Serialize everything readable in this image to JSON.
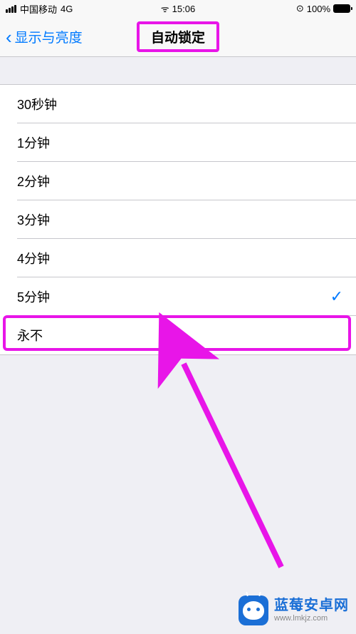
{
  "status": {
    "carrier": "中国移动",
    "network": "4G",
    "time": "15:06",
    "battery_pct": "100%",
    "lock_glyph": "⊙"
  },
  "nav": {
    "back_label": "显示与亮度",
    "title": "自动锁定"
  },
  "options": [
    {
      "label": "30秒钟",
      "selected": false
    },
    {
      "label": "1分钟",
      "selected": false
    },
    {
      "label": "2分钟",
      "selected": false
    },
    {
      "label": "3分钟",
      "selected": false
    },
    {
      "label": "4分钟",
      "selected": false
    },
    {
      "label": "5分钟",
      "selected": true
    },
    {
      "label": "永不",
      "selected": false
    }
  ],
  "annotation": {
    "highlight_color": "#e815e8"
  },
  "watermark": {
    "title": "蓝莓安卓网",
    "url": "www.lmkjz.com"
  }
}
